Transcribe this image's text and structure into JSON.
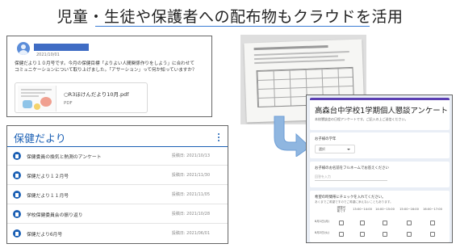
{
  "slide": {
    "title": "児童・生徒や保護者への配布物もクラウドを活用"
  },
  "post": {
    "date": "2021/10/01",
    "body_line1": "保健だより１０月号です。今月の保健目標「よりよい人間関係作りをしよう」に合わせて",
    "body_line2": "コミュニケーションについて取り上げました。「アサーション」って何か知っていますか？",
    "attachment": {
      "name": "○R3ほけんだより10月.pdf",
      "type": "PDF"
    }
  },
  "topic": {
    "title": "保健だより",
    "items": [
      {
        "label": "保健委員の換気と熱測のアンケート",
        "date": "投稿日: 2021/10/13"
      },
      {
        "label": "保健だより１２月号",
        "date": "投稿日: 2021/11/30"
      },
      {
        "label": "保健だより１１月号",
        "date": "投稿日: 2021/11/05"
      },
      {
        "label": "学校保健委員会の振り返り",
        "date": "投稿日: 2021/10/28"
      },
      {
        "label": "保健だより6月号",
        "date": "投稿日: 2021/06/01"
      }
    ]
  },
  "form": {
    "title": "高森台中学校1学期個人懇談アンケート",
    "description": "本校懇談会の日程アンケートです。ご記入の上ご送信ください。",
    "q1": {
      "label": "お子様の学年",
      "selected": "選択"
    },
    "q2": {
      "label": "お子様のお名前をフルネームでお答えください",
      "placeholder": "回答を入力"
    },
    "q3": {
      "label": "希望の時間帯にチェックを入れてください。",
      "sub": "あくまでご希望ですのでご希望に添えないこともあります。",
      "columns": [
        "調整可能です",
        "13:00~14:00",
        "14:00~15:00",
        "15:00~16:00",
        "16:00~17:00"
      ],
      "rows": [
        "8月1日(月)",
        "8月2日(火)"
      ]
    }
  },
  "colors": {
    "accent": "#1a5fb4",
    "form_accent": "#5b3fb2",
    "arrow": "#8fb6e0"
  }
}
